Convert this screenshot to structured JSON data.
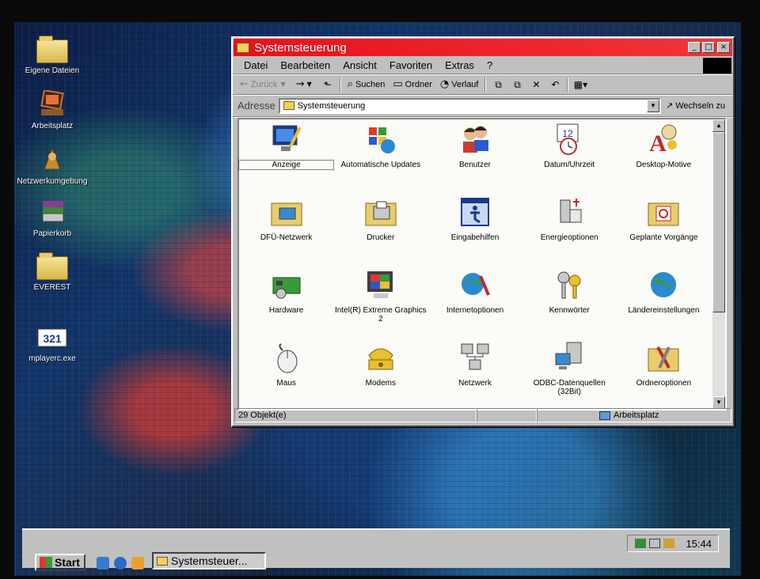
{
  "desktop": {
    "icons": [
      {
        "label": "Eigene Dateien",
        "icon": "folder-icon"
      },
      {
        "label": "Arbeitsplatz",
        "icon": "computer-icon"
      },
      {
        "label": "Netzwerkumgebung",
        "icon": "network-neighborhood-icon"
      },
      {
        "label": "Papierkorb",
        "icon": "recycle-bin-icon"
      },
      {
        "label": "EVEREST",
        "icon": "folder-icon"
      },
      {
        "label": "mplayerc.exe",
        "icon": "media-player-icon"
      }
    ]
  },
  "window": {
    "title": "Systemsteuerung",
    "controls": {
      "minimize": "_",
      "maximize": "□",
      "close": "×"
    },
    "menu": [
      "Datei",
      "Bearbeiten",
      "Ansicht",
      "Favoriten",
      "Extras",
      "?"
    ],
    "toolbar": {
      "back": "Zurück",
      "search": "Suchen",
      "folders": "Ordner",
      "history": "Verlauf"
    },
    "address": {
      "label": "Adresse",
      "value": "Systemsteuerung",
      "go": "Wechseln zu"
    },
    "items": [
      {
        "label": "Anzeige",
        "icon": "display-icon",
        "selected": true
      },
      {
        "label": "Automatische Updates",
        "icon": "windows-update-icon"
      },
      {
        "label": "Benutzer",
        "icon": "users-icon"
      },
      {
        "label": "Datum/Uhrzeit",
        "icon": "date-time-icon"
      },
      {
        "label": "Desktop-Motive",
        "icon": "desktop-themes-icon"
      },
      {
        "label": "DFÜ-Netzwerk",
        "icon": "dialup-network-icon"
      },
      {
        "label": "Drucker",
        "icon": "printer-icon"
      },
      {
        "label": "Eingabehilfen",
        "icon": "accessibility-icon"
      },
      {
        "label": "Energieoptionen",
        "icon": "power-options-icon"
      },
      {
        "label": "Geplante Vorgänge",
        "icon": "scheduled-tasks-icon"
      },
      {
        "label": "Hardware",
        "icon": "hardware-icon"
      },
      {
        "label": "Intel(R) Extreme Graphics 2",
        "icon": "graphics-icon"
      },
      {
        "label": "Internetoptionen",
        "icon": "internet-options-icon"
      },
      {
        "label": "Kennwörter",
        "icon": "passwords-icon"
      },
      {
        "label": "Ländereinstellungen",
        "icon": "regional-settings-icon"
      },
      {
        "label": "Maus",
        "icon": "mouse-icon"
      },
      {
        "label": "Modems",
        "icon": "modem-icon"
      },
      {
        "label": "Netzwerk",
        "icon": "network-icon"
      },
      {
        "label": "ODBC-Datenquellen (32Bit)",
        "icon": "odbc-icon"
      },
      {
        "label": "Ordneroptionen",
        "icon": "folder-options-icon"
      }
    ],
    "status": {
      "count": "29 Objekt(e)",
      "zone": "Arbeitsplatz"
    }
  },
  "taskbar": {
    "start": "Start",
    "task": "Systemsteuer...",
    "clock": "15:44"
  },
  "colors": {
    "title_active": "#e8101a",
    "window_face": "#c0c0c0",
    "content_bg": "#fbfbf7"
  }
}
